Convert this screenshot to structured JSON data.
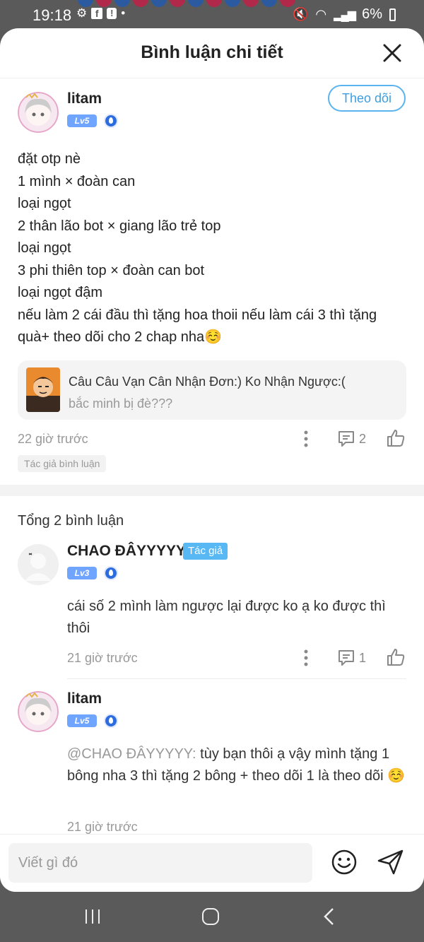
{
  "status_bar": {
    "time": "19:18",
    "battery": "6%"
  },
  "header": {
    "title": "Bình luận chi tiết"
  },
  "main_comment": {
    "username": "litam",
    "level": "Lv5",
    "follow_label": "Theo dõi",
    "body": "đặt otp nè\n1 mình × đoàn can\nloại ngọt\n2 thân lão bot × giang lão trẻ top\nloại ngọt\n3 phi thiên top × đoàn can bot\nloại ngọt đậm\nnếu làm 2 cái đầu thì tặng hoa thoii nếu làm cái 3 thì tặng quà+ theo dõi cho 2 chap nha☺️",
    "reference": {
      "title": "Câu Câu Vạn Cân Nhận Đơn:) Ko Nhận Ngược:(",
      "subtitle": "bắc minh bị đè???"
    },
    "time": "22 giờ trước",
    "reply_count": "2",
    "author_tag": "Tác giả bình luận"
  },
  "replies_section": {
    "total_label": "Tổng 2 bình luận",
    "replies": [
      {
        "username": "CHAO ĐÂYYYYY",
        "author_tag": "Tác giả",
        "level": "Lv3",
        "text": "cái số 2 mình làm ngược lại được ko ạ ko được thì thôi",
        "time": "21 giờ trước",
        "reply_count": "1"
      },
      {
        "username": "litam",
        "level": "Lv5",
        "mention": "@CHAO ĐÂYYYYY:",
        "text": " tùy bạn thôi ạ vậy mình tặng 1 bông nha 3 thì tặng 2 bông + theo dõi 1 là theo dõi ☺️",
        "time": "21 giờ trước"
      }
    ]
  },
  "input": {
    "placeholder": "Viết gì đó"
  },
  "colors": {
    "accent": "#3d9ee0",
    "level_badge": "#6fa4ff",
    "author_tag": "#57b8f3"
  }
}
